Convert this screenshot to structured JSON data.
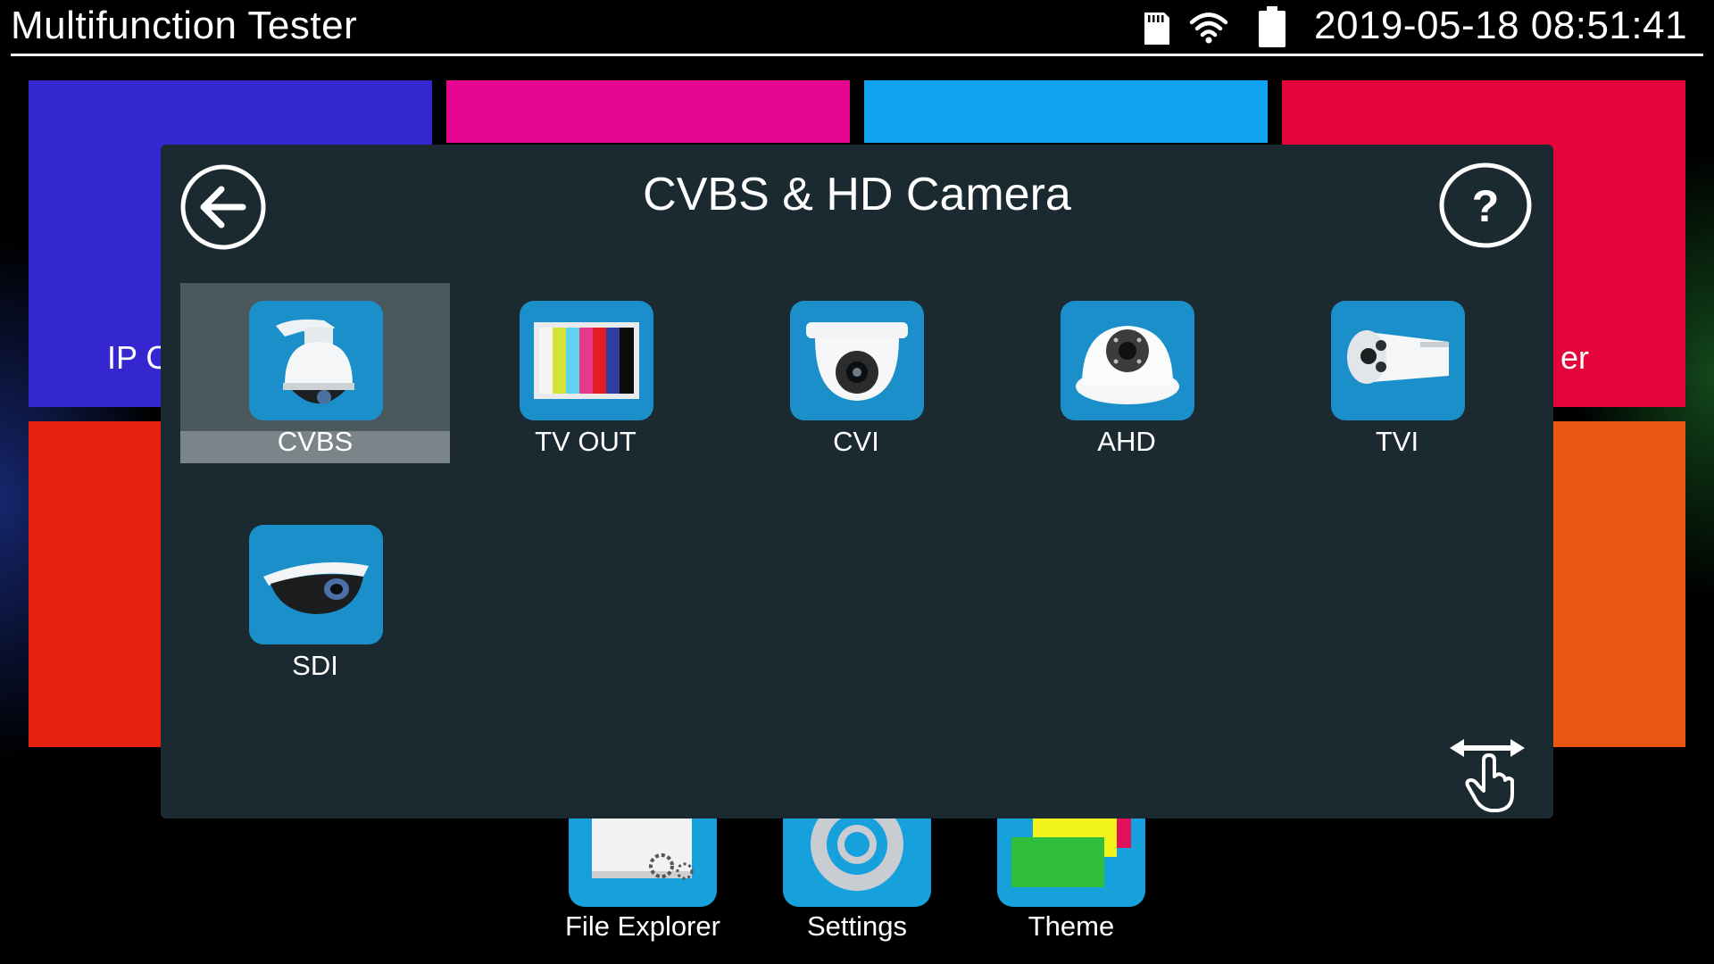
{
  "statusbar": {
    "title": "Multifunction Tester",
    "datetime": "2019-05-18 08:51:41",
    "icons": [
      "sd-card-icon",
      "wifi-icon",
      "battery-icon"
    ]
  },
  "background_tiles": {
    "tile_1_label_fragment": "IP C",
    "tile_4_label_fragment": "er",
    "colors": [
      "#3527d0",
      "#e5048e",
      "#10a3f0",
      "#e4053a",
      "#e8200f",
      "#eb5612"
    ]
  },
  "dock": {
    "items": [
      {
        "label": "File Explorer",
        "icon": "file-explorer-icon"
      },
      {
        "label": "Settings",
        "icon": "gear-icon"
      },
      {
        "label": "Theme",
        "icon": "theme-icon"
      }
    ]
  },
  "dialog": {
    "title": "CVBS & HD Camera",
    "back_icon": "back-arrow-icon",
    "help_icon": "help-icon",
    "swipe_icon": "swipe-hand-icon",
    "items": [
      {
        "label": "CVBS",
        "icon": "ptz-dome-camera-icon",
        "selected": true
      },
      {
        "label": "TV OUT",
        "icon": "color-bars-icon",
        "selected": false
      },
      {
        "label": "CVI",
        "icon": "dome-camera-icon",
        "selected": false
      },
      {
        "label": "AHD",
        "icon": "ir-dome-camera-icon",
        "selected": false
      },
      {
        "label": "TVI",
        "icon": "bullet-camera-icon",
        "selected": false
      },
      {
        "label": "SDI",
        "icon": "eyeball-camera-icon",
        "selected": false
      }
    ]
  },
  "colors": {
    "accent_blue": "#1a8fca",
    "dialog_bg": "#1b2a30",
    "selected_bg": "#4b585e"
  }
}
